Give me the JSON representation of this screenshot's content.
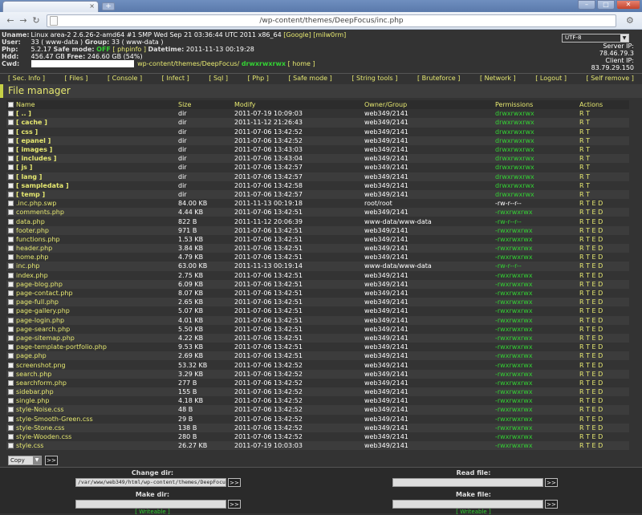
{
  "browser": {
    "tab_close": "×",
    "new_tab": "+",
    "url": "/wp-content/themes/DeepFocus/inc.php",
    "win_min": "–",
    "win_max": "□",
    "win_close": "✕"
  },
  "info": {
    "uname_label": "Uname:",
    "uname": "Linux area-2 2.6.26-2-amd64 #1 SMP Wed Sep 21 03:36:44 UTC 2011 x86_64",
    "google": "[Google]",
    "milw0rm": "[milw0rm]",
    "user_label": "User:",
    "user": "33 ( www-data )",
    "group_label": "Group:",
    "group": "33 ( www-data )",
    "php_label": "Php:",
    "php": "5.2.17",
    "safe_mode_label": "Safe mode:",
    "safe_mode": "OFF",
    "phpinfo": "[ phpinfo ]",
    "datetime_label": "Datetime:",
    "datetime": "2011-11-13 00:19:28",
    "hdd_label": "Hdd:",
    "hdd": "456.47 GB",
    "free_label": "Free:",
    "free": "246.60 GB (54%)",
    "cwd_label": "Cwd:",
    "cwd": "wp-content/themes/DeepFocus/",
    "cwd_perm": "drwxrwxrwx",
    "home": "[ home ]",
    "charset": "UTF-8",
    "server_ip_label": "Server IP:",
    "server_ip": "78.46.79.3",
    "client_ip_label": "Client IP:",
    "client_ip": "83.79.29.150"
  },
  "menu": [
    "[ Sec. Info ]",
    "[ Files ]",
    "[ Console ]",
    "[ Infect ]",
    "[ Sql ]",
    "[ Php ]",
    "[ Safe mode ]",
    "[ String tools ]",
    "[ Bruteforce ]",
    "[ Network ]",
    "[ Logout ]",
    "[ Self remove ]"
  ],
  "file_manager": {
    "title": "File manager",
    "headers": [
      "Name",
      "Size",
      "Modify",
      "Owner/Group",
      "Permissions",
      "Actions"
    ],
    "rows": [
      {
        "name": "[ .. ]",
        "dir": true,
        "size": "dir",
        "modify": "2011-07-19 10:09:03",
        "owner": "web349/2141",
        "perm": "drwxrwxrwx",
        "pw": true,
        "actions": "R T"
      },
      {
        "name": "[ cache ]",
        "dir": true,
        "size": "dir",
        "modify": "2011-11-12 21:26:43",
        "owner": "web349/2141",
        "perm": "drwxrwxrwx",
        "pw": true,
        "actions": "R T"
      },
      {
        "name": "[ css ]",
        "dir": true,
        "size": "dir",
        "modify": "2011-07-06 13:42:52",
        "owner": "web349/2141",
        "perm": "drwxrwxrwx",
        "pw": true,
        "actions": "R T"
      },
      {
        "name": "[ epanel ]",
        "dir": true,
        "size": "dir",
        "modify": "2011-07-06 13:42:52",
        "owner": "web349/2141",
        "perm": "drwxrwxrwx",
        "pw": true,
        "actions": "R T"
      },
      {
        "name": "[ images ]",
        "dir": true,
        "size": "dir",
        "modify": "2011-07-06 13:43:03",
        "owner": "web349/2141",
        "perm": "drwxrwxrwx",
        "pw": true,
        "actions": "R T"
      },
      {
        "name": "[ includes ]",
        "dir": true,
        "size": "dir",
        "modify": "2011-07-06 13:43:04",
        "owner": "web349/2141",
        "perm": "drwxrwxrwx",
        "pw": true,
        "actions": "R T"
      },
      {
        "name": "[ js ]",
        "dir": true,
        "size": "dir",
        "modify": "2011-07-06 13:42:57",
        "owner": "web349/2141",
        "perm": "drwxrwxrwx",
        "pw": true,
        "actions": "R T"
      },
      {
        "name": "[ lang ]",
        "dir": true,
        "size": "dir",
        "modify": "2011-07-06 13:42:57",
        "owner": "web349/2141",
        "perm": "drwxrwxrwx",
        "pw": true,
        "actions": "R T"
      },
      {
        "name": "[ sampledata ]",
        "dir": true,
        "size": "dir",
        "modify": "2011-07-06 13:42:58",
        "owner": "web349/2141",
        "perm": "drwxrwxrwx",
        "pw": true,
        "actions": "R T"
      },
      {
        "name": "[ temp ]",
        "dir": true,
        "size": "dir",
        "modify": "2011-07-06 13:42:57",
        "owner": "web349/2141",
        "perm": "drwxrwxrwx",
        "pw": true,
        "actions": "R T"
      },
      {
        "name": ".inc.php.swp",
        "dir": false,
        "size": "84.00 KB",
        "modify": "2011-11-13 00:19:18",
        "owner": "root/root",
        "perm": "-rw-r--r--",
        "pw": false,
        "actions": "R T E D"
      },
      {
        "name": "comments.php",
        "dir": false,
        "size": "4.44 KB",
        "modify": "2011-07-06 13:42:51",
        "owner": "web349/2141",
        "perm": "-rwxrwxrwx",
        "pw": true,
        "actions": "R T E D"
      },
      {
        "name": "data.php",
        "dir": false,
        "size": "822 B",
        "modify": "2011-11-12 20:06:39",
        "owner": "www-data/www-data",
        "perm": "-rw-r--r--",
        "pw": true,
        "actions": "R T E D"
      },
      {
        "name": "footer.php",
        "dir": false,
        "size": "971 B",
        "modify": "2011-07-06 13:42:51",
        "owner": "web349/2141",
        "perm": "-rwxrwxrwx",
        "pw": true,
        "actions": "R T E D"
      },
      {
        "name": "functions.php",
        "dir": false,
        "size": "1.53 KB",
        "modify": "2011-07-06 13:42:51",
        "owner": "web349/2141",
        "perm": "-rwxrwxrwx",
        "pw": true,
        "actions": "R T E D"
      },
      {
        "name": "header.php",
        "dir": false,
        "size": "3.84 KB",
        "modify": "2011-07-06 13:42:51",
        "owner": "web349/2141",
        "perm": "-rwxrwxrwx",
        "pw": true,
        "actions": "R T E D"
      },
      {
        "name": "home.php",
        "dir": false,
        "size": "4.79 KB",
        "modify": "2011-07-06 13:42:51",
        "owner": "web349/2141",
        "perm": "-rwxrwxrwx",
        "pw": true,
        "actions": "R T E D"
      },
      {
        "name": "inc.php",
        "dir": false,
        "size": "63.00 KB",
        "modify": "2011-11-13 00:19:14",
        "owner": "www-data/www-data",
        "perm": "-rw-r--r--",
        "pw": true,
        "actions": "R T E D"
      },
      {
        "name": "index.php",
        "dir": false,
        "size": "2.75 KB",
        "modify": "2011-07-06 13:42:51",
        "owner": "web349/2141",
        "perm": "-rwxrwxrwx",
        "pw": true,
        "actions": "R T E D"
      },
      {
        "name": "page-blog.php",
        "dir": false,
        "size": "6.09 KB",
        "modify": "2011-07-06 13:42:51",
        "owner": "web349/2141",
        "perm": "-rwxrwxrwx",
        "pw": true,
        "actions": "R T E D"
      },
      {
        "name": "page-contact.php",
        "dir": false,
        "size": "8.07 KB",
        "modify": "2011-07-06 13:42:51",
        "owner": "web349/2141",
        "perm": "-rwxrwxrwx",
        "pw": true,
        "actions": "R T E D"
      },
      {
        "name": "page-full.php",
        "dir": false,
        "size": "2.65 KB",
        "modify": "2011-07-06 13:42:51",
        "owner": "web349/2141",
        "perm": "-rwxrwxrwx",
        "pw": true,
        "actions": "R T E D"
      },
      {
        "name": "page-gallery.php",
        "dir": false,
        "size": "5.07 KB",
        "modify": "2011-07-06 13:42:51",
        "owner": "web349/2141",
        "perm": "-rwxrwxrwx",
        "pw": true,
        "actions": "R T E D"
      },
      {
        "name": "page-login.php",
        "dir": false,
        "size": "4.01 KB",
        "modify": "2011-07-06 13:42:51",
        "owner": "web349/2141",
        "perm": "-rwxrwxrwx",
        "pw": true,
        "actions": "R T E D"
      },
      {
        "name": "page-search.php",
        "dir": false,
        "size": "5.50 KB",
        "modify": "2011-07-06 13:42:51",
        "owner": "web349/2141",
        "perm": "-rwxrwxrwx",
        "pw": true,
        "actions": "R T E D"
      },
      {
        "name": "page-sitemap.php",
        "dir": false,
        "size": "4.22 KB",
        "modify": "2011-07-06 13:42:51",
        "owner": "web349/2141",
        "perm": "-rwxrwxrwx",
        "pw": true,
        "actions": "R T E D"
      },
      {
        "name": "page-template-portfolio.php",
        "dir": false,
        "size": "9.53 KB",
        "modify": "2011-07-06 13:42:51",
        "owner": "web349/2141",
        "perm": "-rwxrwxrwx",
        "pw": true,
        "actions": "R T E D"
      },
      {
        "name": "page.php",
        "dir": false,
        "size": "2.69 KB",
        "modify": "2011-07-06 13:42:51",
        "owner": "web349/2141",
        "perm": "-rwxrwxrwx",
        "pw": true,
        "actions": "R T E D"
      },
      {
        "name": "screenshot.png",
        "dir": false,
        "size": "53.32 KB",
        "modify": "2011-07-06 13:42:52",
        "owner": "web349/2141",
        "perm": "-rwxrwxrwx",
        "pw": true,
        "actions": "R T E D"
      },
      {
        "name": "search.php",
        "dir": false,
        "size": "3.29 KB",
        "modify": "2011-07-06 13:42:52",
        "owner": "web349/2141",
        "perm": "-rwxrwxrwx",
        "pw": true,
        "actions": "R T E D"
      },
      {
        "name": "searchform.php",
        "dir": false,
        "size": "277 B",
        "modify": "2011-07-06 13:42:52",
        "owner": "web349/2141",
        "perm": "-rwxrwxrwx",
        "pw": true,
        "actions": "R T E D"
      },
      {
        "name": "sidebar.php",
        "dir": false,
        "size": "155 B",
        "modify": "2011-07-06 13:42:52",
        "owner": "web349/2141",
        "perm": "-rwxrwxrwx",
        "pw": true,
        "actions": "R T E D"
      },
      {
        "name": "single.php",
        "dir": false,
        "size": "4.18 KB",
        "modify": "2011-07-06 13:42:52",
        "owner": "web349/2141",
        "perm": "-rwxrwxrwx",
        "pw": true,
        "actions": "R T E D"
      },
      {
        "name": "style-Noise.css",
        "dir": false,
        "size": "48 B",
        "modify": "2011-07-06 13:42:52",
        "owner": "web349/2141",
        "perm": "-rwxrwxrwx",
        "pw": true,
        "actions": "R T E D"
      },
      {
        "name": "style-Smooth-Green.css",
        "dir": false,
        "size": "29 B",
        "modify": "2011-07-06 13:42:52",
        "owner": "web349/2141",
        "perm": "-rwxrwxrwx",
        "pw": true,
        "actions": "R T E D"
      },
      {
        "name": "style-Stone.css",
        "dir": false,
        "size": "138 B",
        "modify": "2011-07-06 13:42:52",
        "owner": "web349/2141",
        "perm": "-rwxrwxrwx",
        "pw": true,
        "actions": "R T E D"
      },
      {
        "name": "style-Wooden.css",
        "dir": false,
        "size": "280 B",
        "modify": "2011-07-06 13:42:52",
        "owner": "web349/2141",
        "perm": "-rwxrwxrwx",
        "pw": true,
        "actions": "R T E D"
      },
      {
        "name": "style.css",
        "dir": false,
        "size": "26.27 KB",
        "modify": "2011-07-19 10:03:03",
        "owner": "web349/2141",
        "perm": "-rwxrwxrwx",
        "pw": true,
        "actions": "R T E D"
      }
    ],
    "copy_select": "Copy",
    "go_label": ">>"
  },
  "bottom": {
    "change_dir_label": "Change dir:",
    "change_dir_value": "/var/www/web349/html/wp-content/themes/DeepFocus/",
    "read_file_label": "Read file:",
    "make_dir_label": "Make dir:",
    "make_file_label": "Make file:",
    "writeable_left": "[ Writeable ]",
    "writeable_right": "[ Writeable ]",
    "go_label": ">>"
  },
  "colors": {
    "background": "#333333",
    "link": "#e6e870",
    "writable": "#34d234",
    "header_accent": "#c7d146"
  }
}
